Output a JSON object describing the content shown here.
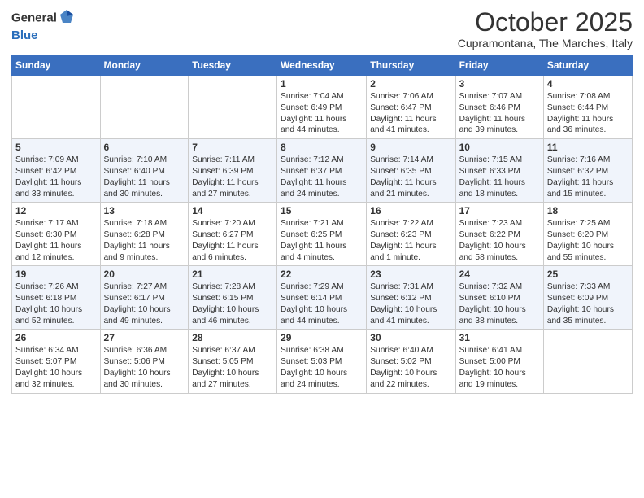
{
  "header": {
    "logo_general": "General",
    "logo_blue": "Blue",
    "month_title": "October 2025",
    "location": "Cupramontana, The Marches, Italy"
  },
  "weekdays": [
    "Sunday",
    "Monday",
    "Tuesday",
    "Wednesday",
    "Thursday",
    "Friday",
    "Saturday"
  ],
  "rows": [
    [
      {
        "day": "",
        "info": ""
      },
      {
        "day": "",
        "info": ""
      },
      {
        "day": "",
        "info": ""
      },
      {
        "day": "1",
        "info": "Sunrise: 7:04 AM\nSunset: 6:49 PM\nDaylight: 11 hours\nand 44 minutes."
      },
      {
        "day": "2",
        "info": "Sunrise: 7:06 AM\nSunset: 6:47 PM\nDaylight: 11 hours\nand 41 minutes."
      },
      {
        "day": "3",
        "info": "Sunrise: 7:07 AM\nSunset: 6:46 PM\nDaylight: 11 hours\nand 39 minutes."
      },
      {
        "day": "4",
        "info": "Sunrise: 7:08 AM\nSunset: 6:44 PM\nDaylight: 11 hours\nand 36 minutes."
      }
    ],
    [
      {
        "day": "5",
        "info": "Sunrise: 7:09 AM\nSunset: 6:42 PM\nDaylight: 11 hours\nand 33 minutes."
      },
      {
        "day": "6",
        "info": "Sunrise: 7:10 AM\nSunset: 6:40 PM\nDaylight: 11 hours\nand 30 minutes."
      },
      {
        "day": "7",
        "info": "Sunrise: 7:11 AM\nSunset: 6:39 PM\nDaylight: 11 hours\nand 27 minutes."
      },
      {
        "day": "8",
        "info": "Sunrise: 7:12 AM\nSunset: 6:37 PM\nDaylight: 11 hours\nand 24 minutes."
      },
      {
        "day": "9",
        "info": "Sunrise: 7:14 AM\nSunset: 6:35 PM\nDaylight: 11 hours\nand 21 minutes."
      },
      {
        "day": "10",
        "info": "Sunrise: 7:15 AM\nSunset: 6:33 PM\nDaylight: 11 hours\nand 18 minutes."
      },
      {
        "day": "11",
        "info": "Sunrise: 7:16 AM\nSunset: 6:32 PM\nDaylight: 11 hours\nand 15 minutes."
      }
    ],
    [
      {
        "day": "12",
        "info": "Sunrise: 7:17 AM\nSunset: 6:30 PM\nDaylight: 11 hours\nand 12 minutes."
      },
      {
        "day": "13",
        "info": "Sunrise: 7:18 AM\nSunset: 6:28 PM\nDaylight: 11 hours\nand 9 minutes."
      },
      {
        "day": "14",
        "info": "Sunrise: 7:20 AM\nSunset: 6:27 PM\nDaylight: 11 hours\nand 6 minutes."
      },
      {
        "day": "15",
        "info": "Sunrise: 7:21 AM\nSunset: 6:25 PM\nDaylight: 11 hours\nand 4 minutes."
      },
      {
        "day": "16",
        "info": "Sunrise: 7:22 AM\nSunset: 6:23 PM\nDaylight: 11 hours\nand 1 minute."
      },
      {
        "day": "17",
        "info": "Sunrise: 7:23 AM\nSunset: 6:22 PM\nDaylight: 10 hours\nand 58 minutes."
      },
      {
        "day": "18",
        "info": "Sunrise: 7:25 AM\nSunset: 6:20 PM\nDaylight: 10 hours\nand 55 minutes."
      }
    ],
    [
      {
        "day": "19",
        "info": "Sunrise: 7:26 AM\nSunset: 6:18 PM\nDaylight: 10 hours\nand 52 minutes."
      },
      {
        "day": "20",
        "info": "Sunrise: 7:27 AM\nSunset: 6:17 PM\nDaylight: 10 hours\nand 49 minutes."
      },
      {
        "day": "21",
        "info": "Sunrise: 7:28 AM\nSunset: 6:15 PM\nDaylight: 10 hours\nand 46 minutes."
      },
      {
        "day": "22",
        "info": "Sunrise: 7:29 AM\nSunset: 6:14 PM\nDaylight: 10 hours\nand 44 minutes."
      },
      {
        "day": "23",
        "info": "Sunrise: 7:31 AM\nSunset: 6:12 PM\nDaylight: 10 hours\nand 41 minutes."
      },
      {
        "day": "24",
        "info": "Sunrise: 7:32 AM\nSunset: 6:10 PM\nDaylight: 10 hours\nand 38 minutes."
      },
      {
        "day": "25",
        "info": "Sunrise: 7:33 AM\nSunset: 6:09 PM\nDaylight: 10 hours\nand 35 minutes."
      }
    ],
    [
      {
        "day": "26",
        "info": "Sunrise: 6:34 AM\nSunset: 5:07 PM\nDaylight: 10 hours\nand 32 minutes."
      },
      {
        "day": "27",
        "info": "Sunrise: 6:36 AM\nSunset: 5:06 PM\nDaylight: 10 hours\nand 30 minutes."
      },
      {
        "day": "28",
        "info": "Sunrise: 6:37 AM\nSunset: 5:05 PM\nDaylight: 10 hours\nand 27 minutes."
      },
      {
        "day": "29",
        "info": "Sunrise: 6:38 AM\nSunset: 5:03 PM\nDaylight: 10 hours\nand 24 minutes."
      },
      {
        "day": "30",
        "info": "Sunrise: 6:40 AM\nSunset: 5:02 PM\nDaylight: 10 hours\nand 22 minutes."
      },
      {
        "day": "31",
        "info": "Sunrise: 6:41 AM\nSunset: 5:00 PM\nDaylight: 10 hours\nand 19 minutes."
      },
      {
        "day": "",
        "info": ""
      }
    ]
  ]
}
